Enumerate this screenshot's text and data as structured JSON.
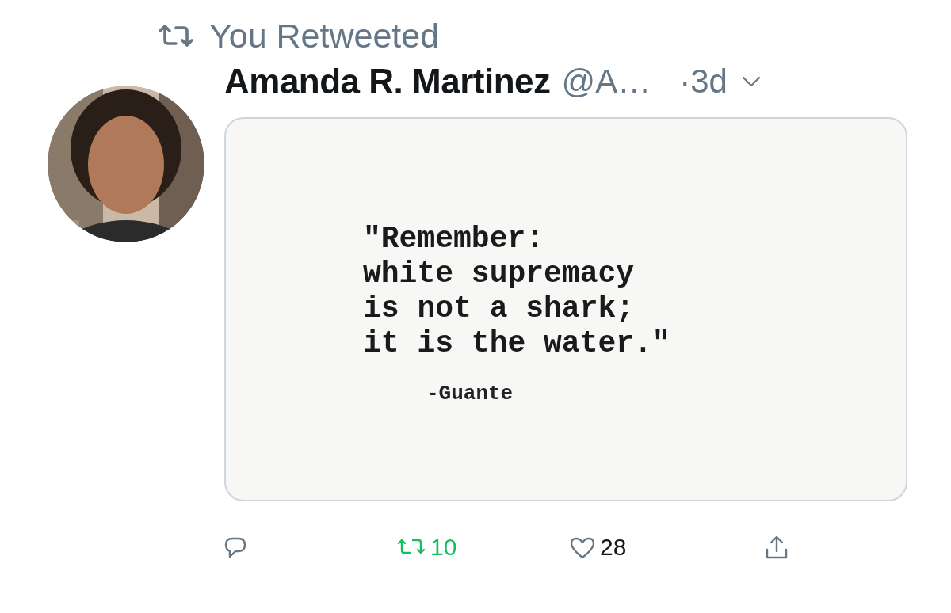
{
  "social_context": {
    "text": "You Retweeted"
  },
  "tweet": {
    "name": "Amanda R. Martinez",
    "handle": "@A…",
    "time": "·3d",
    "media": {
      "lines": [
        "\"Remember:",
        "white supremacy",
        "is not a shark;",
        "it is the water.\""
      ],
      "attribution": "-Guante"
    },
    "actions": [
      {
        "kind": "reply"
      },
      {
        "kind": "retweet",
        "count": "10",
        "selected": true
      },
      {
        "kind": "like",
        "count": "28",
        "selected": false
      },
      {
        "kind": "share"
      }
    ]
  }
}
